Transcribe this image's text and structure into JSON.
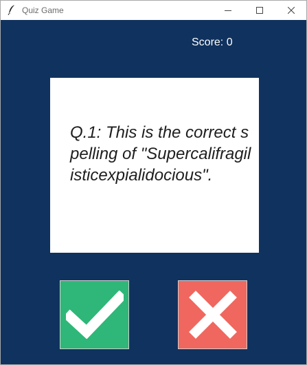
{
  "window": {
    "title": "Quiz Game",
    "icon": "feather-icon",
    "controls": [
      "minimize-icon",
      "maximize-icon",
      "close-icon"
    ]
  },
  "score": {
    "text": "Score: 0"
  },
  "question": {
    "text": "Q.1: This is the correct spelling of \"Supercalifragilisticexpialidocious\"."
  },
  "buttons": {
    "true": {
      "icon": "checkmark-icon"
    },
    "false": {
      "icon": "cross-icon"
    }
  },
  "colors": {
    "background": "#10325e",
    "card": "#ffffff",
    "true_button": "#2eb778",
    "false_button": "#ef675f",
    "score_text": "#ffffff",
    "question_text": "#1e1e1e"
  }
}
